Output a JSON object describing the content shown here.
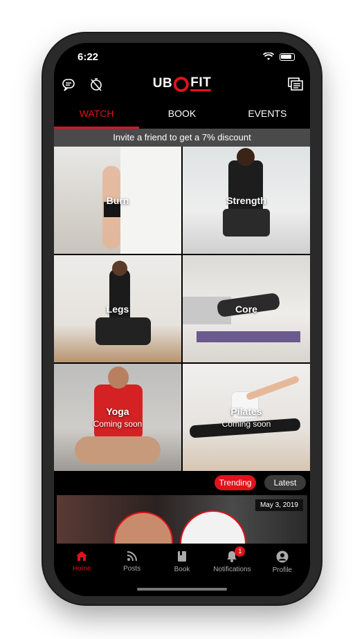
{
  "status": {
    "time": "6:22"
  },
  "logo": {
    "left": "UB",
    "right": "FIT"
  },
  "tabs": [
    {
      "label": "WATCH",
      "active": true
    },
    {
      "label": "BOOK",
      "active": false
    },
    {
      "label": "EVENTS",
      "active": false
    }
  ],
  "invite_banner": "Invite a friend to get a 7% discount",
  "categories": [
    {
      "label": "Burn",
      "sub": ""
    },
    {
      "label": "Strength",
      "sub": ""
    },
    {
      "label": "Legs",
      "sub": ""
    },
    {
      "label": "Core",
      "sub": ""
    },
    {
      "label": "Yoga",
      "sub": "Coming soon"
    },
    {
      "label": "Pilates",
      "sub": "Coming soon"
    }
  ],
  "filters": {
    "trending": "Trending",
    "latest": "Latest"
  },
  "feed": {
    "date": "May 3, 2019"
  },
  "nav": [
    {
      "label": "Home",
      "icon": "home-icon",
      "active": true
    },
    {
      "label": "Posts",
      "icon": "rss-icon",
      "active": false
    },
    {
      "label": "Book",
      "icon": "book-icon",
      "active": false
    },
    {
      "label": "Notifications",
      "icon": "bell-icon",
      "active": false,
      "badge": "1"
    },
    {
      "label": "Profile",
      "icon": "profile-icon",
      "active": false
    }
  ],
  "colors": {
    "accent": "#e0121c",
    "background": "#000000",
    "banner": "#4a4a4a"
  }
}
